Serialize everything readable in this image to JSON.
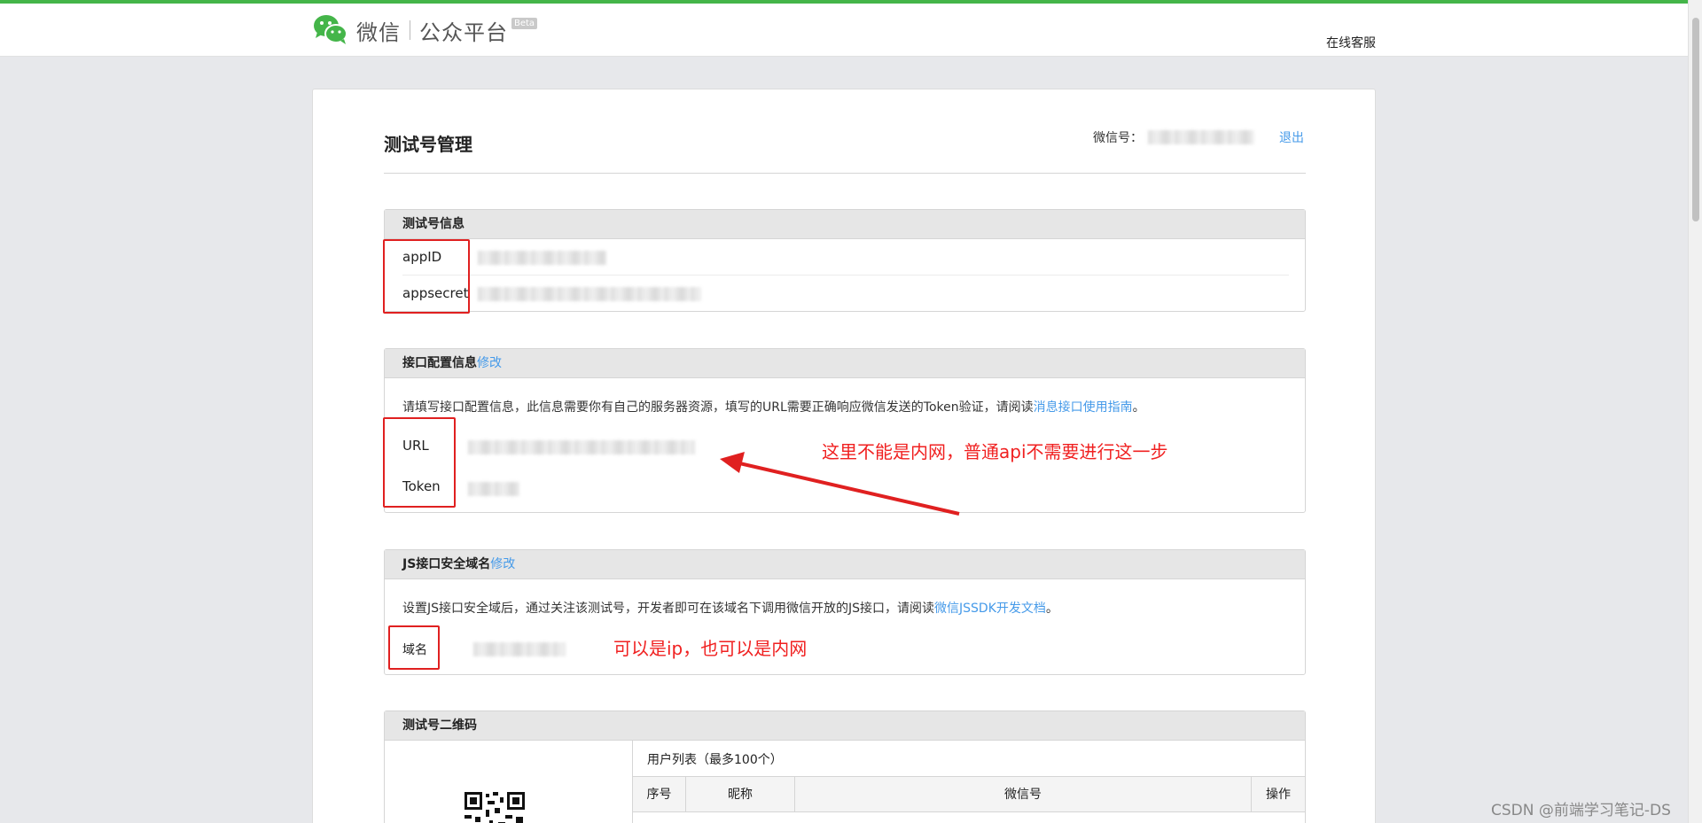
{
  "header": {
    "logo_text": "微信",
    "logo_sub": "公众平台",
    "beta": "Beta",
    "help_link": "在线客服"
  },
  "page": {
    "title": "测试号管理",
    "account_label": "微信号：",
    "logout": "退出"
  },
  "test_account_info": {
    "title": "测试号信息",
    "appid_label": "appID",
    "appsecret_label": "appsecret"
  },
  "interface_config": {
    "title": "接口配置信息",
    "edit": "修改",
    "desc_before": "请填写接口配置信息，此信息需要你有自己的服务器资源，填写的URL需要正确响应微信发送的Token验证，请阅读",
    "desc_link": "消息接口使用指南",
    "desc_after": "。",
    "url_label": "URL",
    "token_label": "Token"
  },
  "js_domain": {
    "title": "JS接口安全域名",
    "edit": "修改",
    "desc_before": "设置JS接口安全域后，通过关注该测试号，开发者即可在该域名下调用微信开放的JS接口，请阅读",
    "desc_link": "微信JSSDK开发文档",
    "desc_after": "。",
    "domain_label": "域名"
  },
  "qr_panel": {
    "title": "测试号二维码",
    "user_list_title": "用户列表（最多100个）",
    "columns": [
      "序号",
      "昵称",
      "微信号",
      "操作"
    ]
  },
  "annotations": {
    "url_note": "这里不能是内网，普通api不需要进行这一步",
    "domain_note": "可以是ip，也可以是内网"
  },
  "watermark": "CSDN @前端学习笔记-DS",
  "colors": {
    "brand_green": "#44b549",
    "link_blue": "#459ae9",
    "annotation_red": "#f02020"
  }
}
